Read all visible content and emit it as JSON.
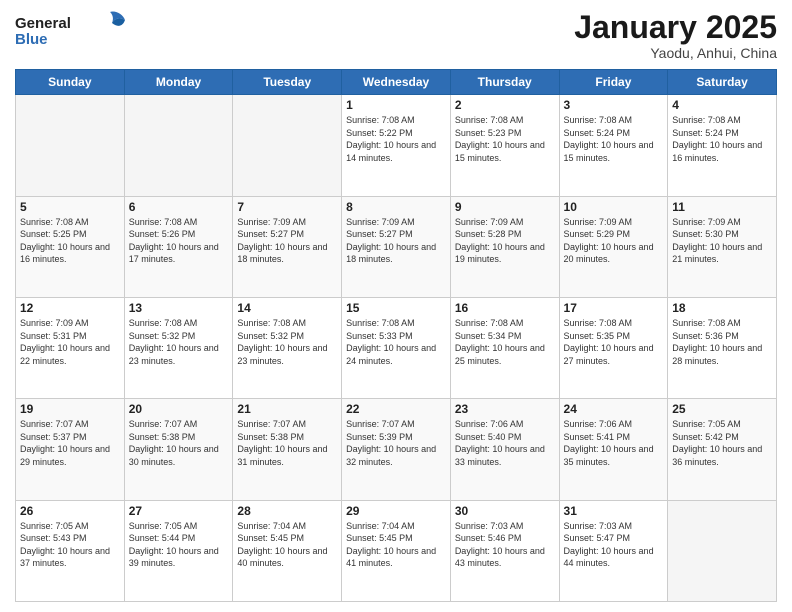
{
  "header": {
    "logo_text_general": "General",
    "logo_text_blue": "Blue",
    "month_title": "January 2025",
    "location": "Yaodu, Anhui, China"
  },
  "weekdays": [
    "Sunday",
    "Monday",
    "Tuesday",
    "Wednesday",
    "Thursday",
    "Friday",
    "Saturday"
  ],
  "weeks": [
    [
      {
        "day": "",
        "empty": true
      },
      {
        "day": "",
        "empty": true
      },
      {
        "day": "",
        "empty": true
      },
      {
        "day": "1",
        "sunrise": "7:08 AM",
        "sunset": "5:22 PM",
        "daylight": "10 hours and 14 minutes."
      },
      {
        "day": "2",
        "sunrise": "7:08 AM",
        "sunset": "5:23 PM",
        "daylight": "10 hours and 15 minutes."
      },
      {
        "day": "3",
        "sunrise": "7:08 AM",
        "sunset": "5:24 PM",
        "daylight": "10 hours and 15 minutes."
      },
      {
        "day": "4",
        "sunrise": "7:08 AM",
        "sunset": "5:24 PM",
        "daylight": "10 hours and 16 minutes."
      }
    ],
    [
      {
        "day": "5",
        "sunrise": "7:08 AM",
        "sunset": "5:25 PM",
        "daylight": "10 hours and 16 minutes."
      },
      {
        "day": "6",
        "sunrise": "7:08 AM",
        "sunset": "5:26 PM",
        "daylight": "10 hours and 17 minutes."
      },
      {
        "day": "7",
        "sunrise": "7:09 AM",
        "sunset": "5:27 PM",
        "daylight": "10 hours and 18 minutes."
      },
      {
        "day": "8",
        "sunrise": "7:09 AM",
        "sunset": "5:27 PM",
        "daylight": "10 hours and 18 minutes."
      },
      {
        "day": "9",
        "sunrise": "7:09 AM",
        "sunset": "5:28 PM",
        "daylight": "10 hours and 19 minutes."
      },
      {
        "day": "10",
        "sunrise": "7:09 AM",
        "sunset": "5:29 PM",
        "daylight": "10 hours and 20 minutes."
      },
      {
        "day": "11",
        "sunrise": "7:09 AM",
        "sunset": "5:30 PM",
        "daylight": "10 hours and 21 minutes."
      }
    ],
    [
      {
        "day": "12",
        "sunrise": "7:09 AM",
        "sunset": "5:31 PM",
        "daylight": "10 hours and 22 minutes."
      },
      {
        "day": "13",
        "sunrise": "7:08 AM",
        "sunset": "5:32 PM",
        "daylight": "10 hours and 23 minutes."
      },
      {
        "day": "14",
        "sunrise": "7:08 AM",
        "sunset": "5:32 PM",
        "daylight": "10 hours and 23 minutes."
      },
      {
        "day": "15",
        "sunrise": "7:08 AM",
        "sunset": "5:33 PM",
        "daylight": "10 hours and 24 minutes."
      },
      {
        "day": "16",
        "sunrise": "7:08 AM",
        "sunset": "5:34 PM",
        "daylight": "10 hours and 25 minutes."
      },
      {
        "day": "17",
        "sunrise": "7:08 AM",
        "sunset": "5:35 PM",
        "daylight": "10 hours and 27 minutes."
      },
      {
        "day": "18",
        "sunrise": "7:08 AM",
        "sunset": "5:36 PM",
        "daylight": "10 hours and 28 minutes."
      }
    ],
    [
      {
        "day": "19",
        "sunrise": "7:07 AM",
        "sunset": "5:37 PM",
        "daylight": "10 hours and 29 minutes."
      },
      {
        "day": "20",
        "sunrise": "7:07 AM",
        "sunset": "5:38 PM",
        "daylight": "10 hours and 30 minutes."
      },
      {
        "day": "21",
        "sunrise": "7:07 AM",
        "sunset": "5:38 PM",
        "daylight": "10 hours and 31 minutes."
      },
      {
        "day": "22",
        "sunrise": "7:07 AM",
        "sunset": "5:39 PM",
        "daylight": "10 hours and 32 minutes."
      },
      {
        "day": "23",
        "sunrise": "7:06 AM",
        "sunset": "5:40 PM",
        "daylight": "10 hours and 33 minutes."
      },
      {
        "day": "24",
        "sunrise": "7:06 AM",
        "sunset": "5:41 PM",
        "daylight": "10 hours and 35 minutes."
      },
      {
        "day": "25",
        "sunrise": "7:05 AM",
        "sunset": "5:42 PM",
        "daylight": "10 hours and 36 minutes."
      }
    ],
    [
      {
        "day": "26",
        "sunrise": "7:05 AM",
        "sunset": "5:43 PM",
        "daylight": "10 hours and 37 minutes."
      },
      {
        "day": "27",
        "sunrise": "7:05 AM",
        "sunset": "5:44 PM",
        "daylight": "10 hours and 39 minutes."
      },
      {
        "day": "28",
        "sunrise": "7:04 AM",
        "sunset": "5:45 PM",
        "daylight": "10 hours and 40 minutes."
      },
      {
        "day": "29",
        "sunrise": "7:04 AM",
        "sunset": "5:45 PM",
        "daylight": "10 hours and 41 minutes."
      },
      {
        "day": "30",
        "sunrise": "7:03 AM",
        "sunset": "5:46 PM",
        "daylight": "10 hours and 43 minutes."
      },
      {
        "day": "31",
        "sunrise": "7:03 AM",
        "sunset": "5:47 PM",
        "daylight": "10 hours and 44 minutes."
      },
      {
        "day": "",
        "empty": true
      }
    ]
  ]
}
